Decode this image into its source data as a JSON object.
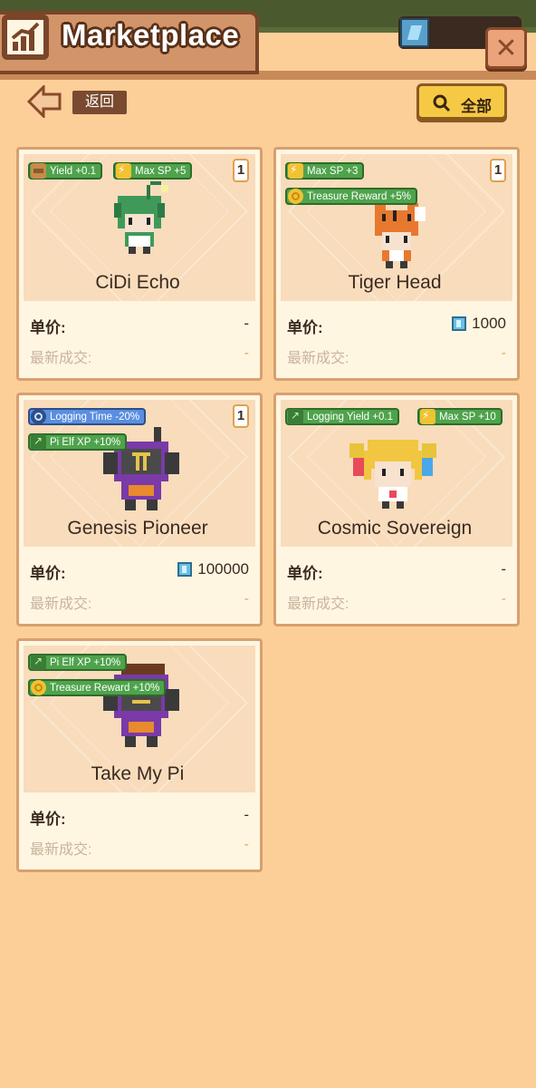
{
  "header": {
    "title": "Marketplace"
  },
  "toolbar": {
    "back_label": "返回",
    "filter_label": "全部"
  },
  "labels": {
    "price": "单价:",
    "last_deal": "最新成交:"
  },
  "cards": [
    {
      "name": "CiDi Echo",
      "quantity": "1",
      "badges": [
        "Yield +0.1",
        "Max SP +5"
      ],
      "price": "-",
      "last_deal": "-"
    },
    {
      "name": "Tiger Head",
      "quantity": "1",
      "badges": [
        "Max SP +3",
        "Treasure Reward +5%"
      ],
      "price": "1000",
      "last_deal": "-"
    },
    {
      "name": "Genesis Pioneer",
      "quantity": "1",
      "badges": [
        "Logging Time -20%",
        "Pi Elf XP +10%"
      ],
      "price": "100000",
      "last_deal": "-"
    },
    {
      "name": "Cosmic Sovereign",
      "quantity": "",
      "badges": [
        "Logging Yield +0.1",
        "Max SP +10"
      ],
      "price": "-",
      "last_deal": "-"
    },
    {
      "name": "Take My Pi",
      "quantity": "",
      "badges": [
        "Pi Elf XP +10%",
        "Treasure Reward +10%"
      ],
      "price": "-",
      "last_deal": "-"
    }
  ],
  "colors": {
    "background": "#fccf99",
    "card_bg": "#fff6e2",
    "badge_green": "#4fa34c",
    "badge_blue": "#5a8ee0",
    "filter_button": "#f6c945"
  }
}
